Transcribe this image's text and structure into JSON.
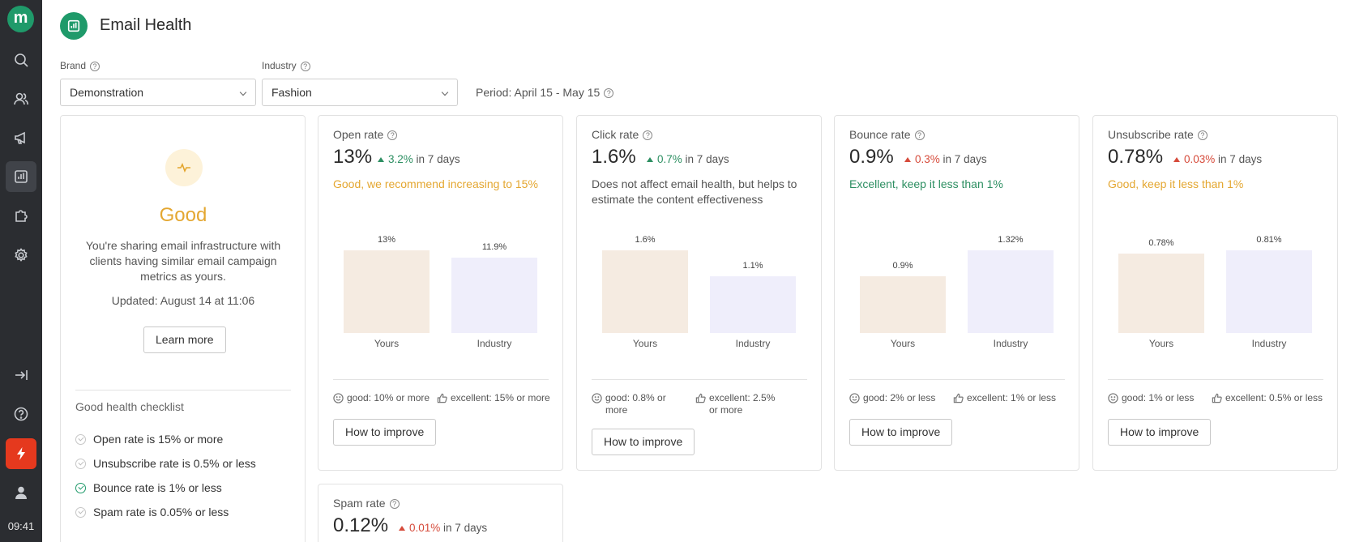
{
  "sidebar": {
    "logo": "m",
    "clock": "09:41",
    "icons": [
      "search-icon",
      "users-icon",
      "megaphone-icon",
      "bar-chart-icon",
      "puzzle-icon",
      "gear-icon",
      "exit-icon",
      "help-icon",
      "bolt-icon",
      "user-icon"
    ]
  },
  "header": {
    "title": "Email Health"
  },
  "filters": {
    "brand_label": "Brand",
    "brand_value": "Demonstration",
    "industry_label": "Industry",
    "industry_value": "Fashion",
    "period": "Period: April 15 - May 15"
  },
  "health": {
    "status": "Good",
    "description": "You're sharing email infrastructure with clients having similar email campaign metrics as yours.",
    "updated": "Updated: August 14 at 11:06",
    "learn_more": "Learn more",
    "checklist_title": "Good health checklist",
    "checklist": [
      {
        "text": "Open rate is 15% or more",
        "done": false
      },
      {
        "text": "Unsubscribe rate is 0.5% or less",
        "done": false
      },
      {
        "text": "Bounce rate is 1% or less",
        "done": true
      },
      {
        "text": "Spam rate is 0.05% or less",
        "done": false
      }
    ]
  },
  "metrics": [
    {
      "title": "Open rate",
      "value": "13%",
      "delta": "3.2%",
      "delta_suffix": "in 7 days",
      "delta_color": "#2d8f62",
      "note": "Good, we recommend increasing to 15%",
      "note_color": "#e4a731",
      "yours_label": "13%",
      "industry_label": "11.9%",
      "yours_value": 13,
      "industry_value": 11.9,
      "bar_yours": "Yours",
      "bar_industry": "Industry",
      "good": "good: 10% or more",
      "excellent": "excellent: 15% or more",
      "button": "How to improve"
    },
    {
      "title": "Click rate",
      "value": "1.6%",
      "delta": "0.7%",
      "delta_suffix": "in 7 days",
      "delta_color": "#2d8f62",
      "note": "Does not affect email health, but helps to estimate the content effectiveness",
      "note_color": "#555555",
      "yours_label": "1.6%",
      "industry_label": "1.1%",
      "yours_value": 1.6,
      "industry_value": 1.1,
      "bar_yours": "Yours",
      "bar_industry": "Industry",
      "good": "good: 0.8% or more",
      "excellent": "excellent: 2.5% or more",
      "button": "How to improve"
    },
    {
      "title": "Bounce rate",
      "value": "0.9%",
      "delta": "0.3%",
      "delta_suffix": "in 7 days",
      "delta_color": "#d64b3b",
      "note": "Excellent, keep it less than 1%",
      "note_color": "#2d8f62",
      "yours_label": "0.9%",
      "industry_label": "1.32%",
      "yours_value": 0.9,
      "industry_value": 1.32,
      "bar_yours": "Yours",
      "bar_industry": "Industry",
      "good": "good: 2% or less",
      "excellent": "excellent: 1% or less",
      "button": "How to improve"
    },
    {
      "title": "Unsubscribe rate",
      "value": "0.78%",
      "delta": "0.03%",
      "delta_suffix": "in 7 days",
      "delta_color": "#d64b3b",
      "note": "Good, keep it less than 1%",
      "note_color": "#e4a731",
      "yours_label": "0.78%",
      "industry_label": "0.81%",
      "yours_value": 0.78,
      "industry_value": 0.81,
      "bar_yours": "Yours",
      "bar_industry": "Industry",
      "good": "good: 1% or less",
      "excellent": "excellent: 0.5% or less",
      "button": "How to improve"
    }
  ],
  "spam": {
    "title": "Spam rate",
    "value": "0.12%",
    "delta": "0.01%",
    "delta_suffix": "in 7 days",
    "delta_color": "#d64b3b"
  },
  "colors": {
    "accent": "#1f9a6a",
    "yours_bar": "#f5ebe1",
    "industry_bar": "#efeefb",
    "sidebar": "#2b2d31"
  }
}
